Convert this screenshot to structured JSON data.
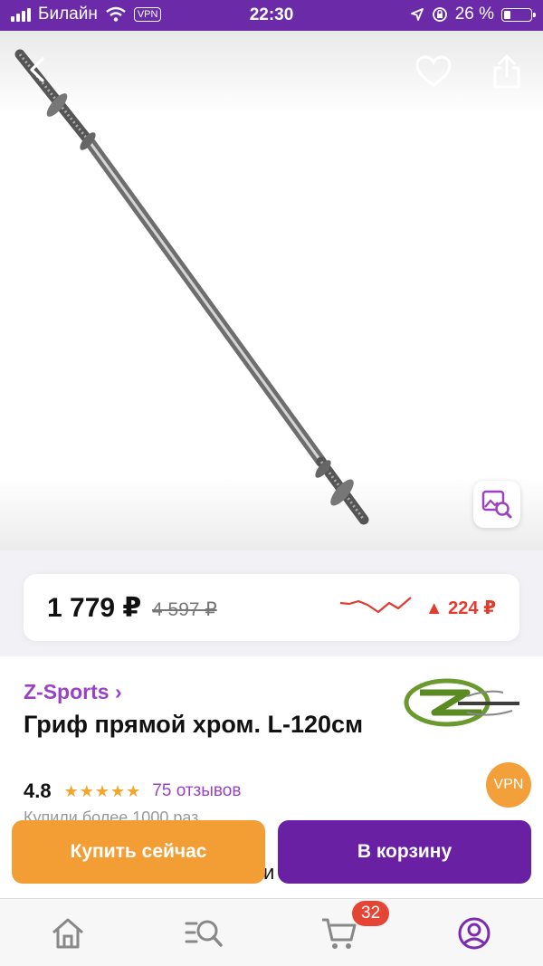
{
  "status_bar": {
    "carrier": "Билайн",
    "vpn": "VPN",
    "time": "22:30",
    "battery_percent": "26 %",
    "battery_level": 0.26
  },
  "product": {
    "price": "1 779 ₽",
    "old_price": "4 597 ₽",
    "price_change": "▲ 224 ₽",
    "brand": "Z-Sports ›",
    "title": "Гриф прямой хром. L-120см",
    "rating": "4.8",
    "stars": "★★★★★",
    "reviews": "75 отзывов",
    "bought": "Купили более 1000 раз",
    "cut_text": "и"
  },
  "floating_badge": {
    "label": "VPN"
  },
  "actions": {
    "buy_now": "Купить сейчас",
    "add_to_cart": "В корзину"
  },
  "tabbar": {
    "cart_count": "32",
    "items": [
      "home-icon",
      "catalog-search-icon",
      "cart-icon",
      "profile-icon"
    ]
  },
  "colors": {
    "accent_purple": "#6a20a3",
    "brand_purple": "#9a41c4",
    "orange": "#f39e34",
    "price_up_red": "#e33b2e"
  }
}
